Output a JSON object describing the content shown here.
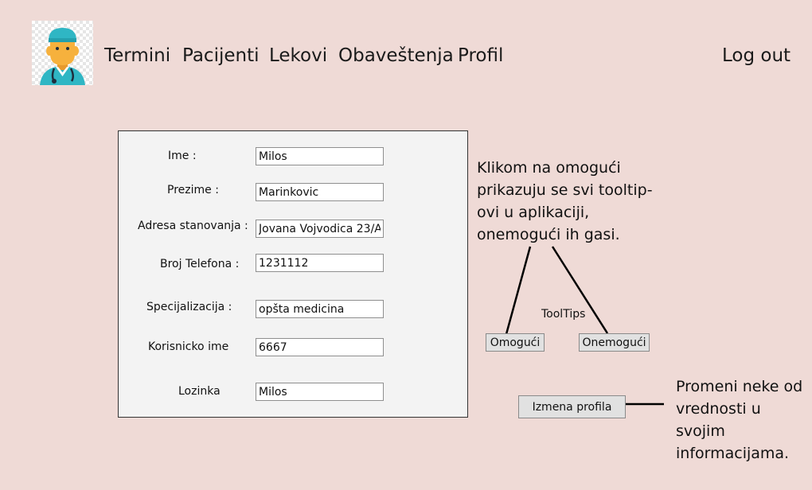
{
  "nav": {
    "links": [
      "Termini",
      "Pacijenti",
      "Lekovi",
      "Obaveštenja",
      "Profil"
    ],
    "logout": "Log out"
  },
  "profile_form": {
    "fields": [
      {
        "label": "Ime :",
        "value": "Milos"
      },
      {
        "label": "Prezime :",
        "value": "Marinkovic"
      },
      {
        "label": "Adresa stanovanja :",
        "value": "Jovana Vojvodica 23/A"
      },
      {
        "label": "Broj Telefona :",
        "value": "1231112"
      },
      {
        "label": "Specijalizacija :",
        "value": "opšta medicina"
      },
      {
        "label": "Korisnicko ime",
        "value": "6667"
      },
      {
        "label": "Lozinka",
        "value": "Milos"
      }
    ]
  },
  "tooltips": {
    "note": "Klikom na omogući\nprikazuju se svi tooltip-\novi u aplikaciji,\nonemogući ih gasi.",
    "label": "ToolTips",
    "enable_button": "Omogući",
    "disable_button": "Onemogući"
  },
  "edit_profile": {
    "button": "Izmena profila",
    "note": "Promeni neke od\nvrednosti u svojim\ninformacijama."
  },
  "colors": {
    "background": "#efdad6",
    "panel": "#f3f3f3",
    "button": "#e1e1e1",
    "avatar_cap": "#2fb6c4",
    "avatar_skin": "#f6b13d"
  },
  "icons": {
    "avatar": "doctor-avatar-icon"
  }
}
